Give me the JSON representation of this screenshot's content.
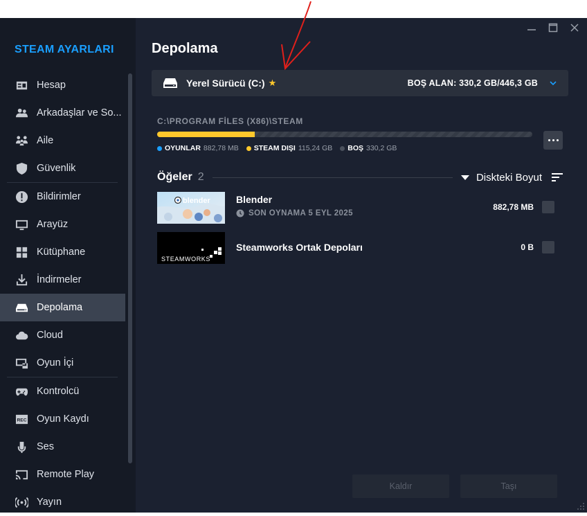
{
  "sidebar": {
    "title": "STEAM AYARLARI",
    "items": [
      {
        "label": "Hesap",
        "icon": "account-card-icon"
      },
      {
        "label": "Arkadaşlar ve So...",
        "icon": "friends-icon"
      },
      {
        "label": "Aile",
        "icon": "family-icon"
      },
      {
        "label": "Güvenlik",
        "icon": "shield-icon"
      },
      {
        "label": "Bildirimler",
        "icon": "alert-icon"
      },
      {
        "label": "Arayüz",
        "icon": "monitor-icon"
      },
      {
        "label": "Kütüphane",
        "icon": "grid-icon"
      },
      {
        "label": "İndirmeler",
        "icon": "download-icon"
      },
      {
        "label": "Depolama",
        "icon": "drive-icon"
      },
      {
        "label": "Cloud",
        "icon": "cloud-icon"
      },
      {
        "label": "Oyun İçi",
        "icon": "overlay-icon"
      },
      {
        "label": "Kontrolcü",
        "icon": "gamepad-icon"
      },
      {
        "label": "Oyun Kaydı",
        "icon": "rec-icon"
      },
      {
        "label": "Ses",
        "icon": "microphone-icon"
      },
      {
        "label": "Remote Play",
        "icon": "cast-icon"
      },
      {
        "label": "Yayın",
        "icon": "broadcast-icon"
      }
    ],
    "active": "Depolama"
  },
  "main": {
    "title": "Depolama",
    "drive": {
      "name": "Yerel Sürücü (C:)",
      "star": "★",
      "free_space": "BOŞ ALAN: 330,2 GB/446,3 GB"
    },
    "path": "C:\\PROGRAM FİLES (X86)\\STEAM",
    "usage": {
      "used_fraction": 0.26,
      "legend": [
        {
          "label": "OYUNLAR",
          "value": "882,78 MB",
          "color": "#1a9fff"
        },
        {
          "label": "STEAM DIŞI",
          "value": "115,24 GB",
          "color": "#ffc82c"
        },
        {
          "label": "BOŞ",
          "value": "330,2 GB",
          "color": "#4a505c"
        }
      ]
    },
    "items_header": {
      "label": "Öğeler",
      "count": "2",
      "sort_label": "Diskteki Boyut"
    },
    "games": [
      {
        "name": "Blender",
        "last_played": "SON OYNAMA 5 EYL 2025",
        "size": "882,78 MB",
        "thumb_text": "blender"
      },
      {
        "name": "Steamworks Ortak Depoları",
        "last_played": "",
        "size": "0 B",
        "thumb_text": "STEAMWORKS"
      }
    ],
    "buttons": {
      "uninstall": "Kaldır",
      "move": "Taşı"
    }
  },
  "colors": {
    "accent": "#1a9fff",
    "star": "#ffc82c",
    "annotation_arrow": "#e0201b"
  }
}
